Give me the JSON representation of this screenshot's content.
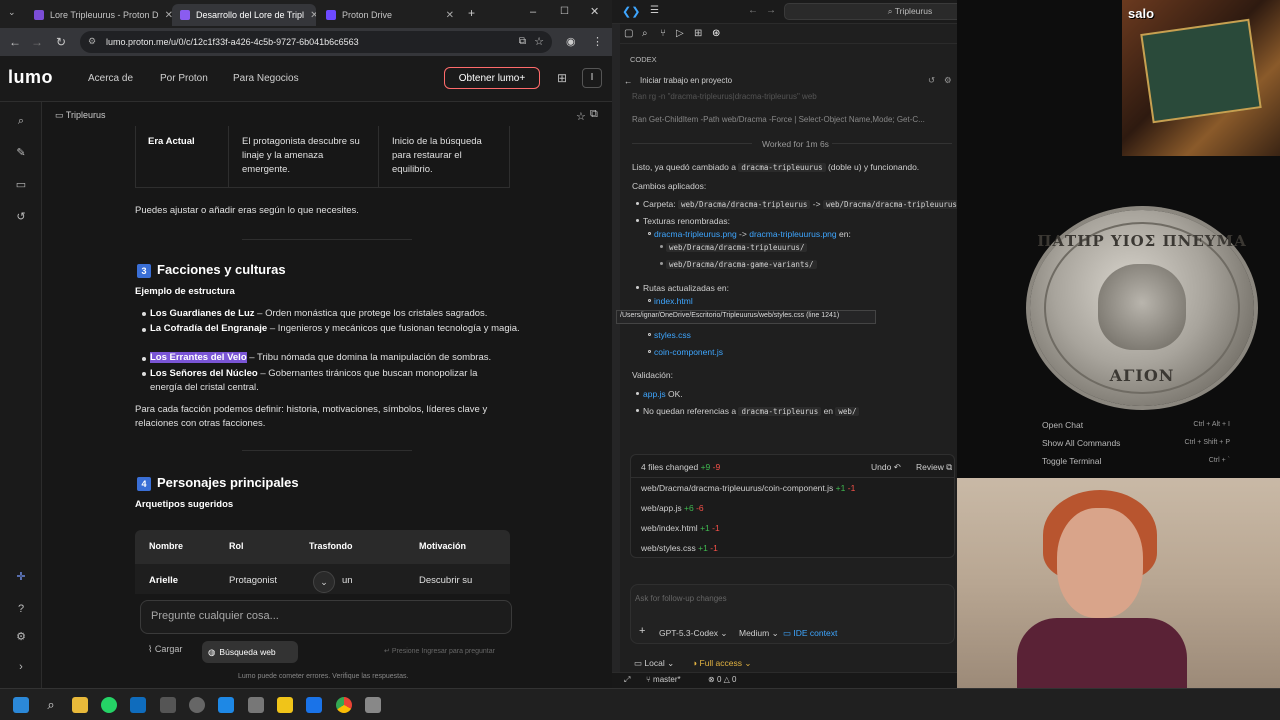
{
  "browser": {
    "tabs": [
      {
        "label": "Lore Tripleuurus - Proton D",
        "active": false,
        "favicon_color": "#7b4dd6"
      },
      {
        "label": "Desarrollo del Lore de Tripl",
        "active": true,
        "favicon_color": "#8a5cf0"
      },
      {
        "label": "Proton Drive",
        "active": false,
        "favicon_color": "#6d4aff"
      }
    ],
    "url": "lumo.proton.me/u/0/c/12c1f33f-a426-4c5b-9727-6b041b6c6563"
  },
  "lumo": {
    "logo": "lumo",
    "nav": [
      "Acerca de",
      "Por Proton",
      "Para Negocios"
    ],
    "cta": "Obtener lumo+",
    "breadcrumb": "Tripleurus",
    "era_row": {
      "col1": "Era Actual",
      "col2": "El protagonista descubre su linaje y la amenaza emergente.",
      "col3": "Inicio de la búsqueda para restaurar el equilibrio."
    },
    "adjust_note": "Puedes ajustar o añadir eras según lo que necesites.",
    "section3": {
      "number": "3",
      "title": "Facciones y culturas",
      "subtitle": "Ejemplo de estructura",
      "items": [
        {
          "name": "Los Guardianes de Luz",
          "desc": " – Orden monástica que protege los cristales sagrados."
        },
        {
          "name": "La Cofradía del Engranaje",
          "desc": " – Ingenieros y mecánicos que fusionan tecnología y magia."
        },
        {
          "name": "Los Errantes del Velo",
          "desc": " – Tribu nómada que domina la manipulación de sombras."
        },
        {
          "name": "Los Señores del Núcleo",
          "desc": " – Gobernantes tiránicos que buscan monopolizar la energía del cristal central."
        }
      ],
      "footer": "Para cada facción podemos definir: historia, motivaciones, símbolos, líderes clave y relaciones con otras facciones."
    },
    "section4": {
      "number": "4",
      "title": "Personajes principales",
      "subtitle": "Arquetipos sugeridos",
      "columns": [
        "Nombre",
        "Rol",
        "Trasfondo",
        "Motivación"
      ],
      "row": [
        "Arielle",
        "Protagonist",
        "un",
        "Descubrir su"
      ]
    },
    "prompt_placeholder": "Pregunte cualquier cosa...",
    "upload_label": "Cargar",
    "websearch_label": "Búsqueda web",
    "enter_hint": "Presione Ingresar para preguntar",
    "disclaimer": "Lumo puede cometer errores. Verifique las respuestas."
  },
  "vscode": {
    "search_text": "Tripleurus",
    "panel_title": "CODEX",
    "task_title": "Iniciar trabajo en proyecto",
    "cmd_line1": "Ran rg -n \"dracma-tripleurus|dracma-tripleurus\" web",
    "cmd_line2": "Ran Get-ChildItem -Path web/Dracma -Force | Select-Object Name,Mode; Get-C...",
    "worked": "Worked for 1m 6s",
    "summary_pre": "Listo, ya quedó cambiado a ",
    "summary_code": "dracma-tripleuurus",
    "summary_post": " (doble u) y funcionando.",
    "changes_title": "Cambios aplicados:",
    "carpeta_label": "Carpeta: ",
    "carpeta_from": "web/Dracma/dracma-tripleurus",
    "carpeta_to": "web/Dracma/dracma-tripleuurus",
    "texturas_label": "Texturas renombradas:",
    "tex_from": "dracma-tripleurus.png",
    "tex_to": "dracma-tripleuurus.png",
    "tex_en": " en:",
    "tex_path1": "web/Dracma/dracma-tripleuurus/",
    "tex_path2": "web/Dracma/dracma-game-variants/",
    "rutas_label": "Rutas actualizadas en:",
    "rutas": [
      "index.html",
      "styles.css",
      "coin-component.js"
    ],
    "tooltip": "/Users/ignar/OneDrive/Escritorio/Tripleuurus/web/styles.css (line 1241)",
    "validacion": "Validación:",
    "val1_link": "app.js",
    "val1_rest": " OK.",
    "val2_pre": "No quedan referencias a ",
    "val2_code": "dracma-tripleurus",
    "val2_mid": " en ",
    "val2_code2": "web/",
    "files_changed": "4 files changed",
    "files_plus": "+9",
    "files_minus": "-9",
    "undo": "Undo",
    "review": "Review",
    "files": [
      {
        "path": "web/Dracma/dracma-tripleuurus/coin-component.js",
        "plus": "+1",
        "minus": "-1"
      },
      {
        "path": "web/app.js",
        "plus": "+6",
        "minus": "-6"
      },
      {
        "path": "web/index.html",
        "plus": "+1",
        "minus": "-1"
      },
      {
        "path": "web/styles.css",
        "plus": "+1",
        "minus": "-1"
      }
    ],
    "followup_placeholder": "Ask for follow-up changes",
    "model": "GPT-5.3-Codex",
    "effort": "Medium",
    "ide_context": "IDE context",
    "local": "Local",
    "access": "Full access",
    "branch": "master*",
    "errors": "0",
    "warnings": "0"
  },
  "commands": [
    {
      "label": "Open Chat",
      "keys": "Ctrl + Alt + I"
    },
    {
      "label": "Show All Commands",
      "keys": "Ctrl + Shift + P"
    },
    {
      "label": "Toggle Terminal",
      "keys": "Ctrl + `"
    }
  ],
  "coin": {
    "top": "ΠΑΤΗΡ ΥΙΟΣ ΠΝΕΥΜΑ",
    "bottom": "ΑΓΙΟΝ"
  },
  "overlay_label": "salo"
}
